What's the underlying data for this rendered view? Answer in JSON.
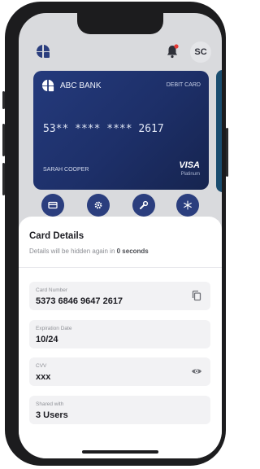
{
  "header": {
    "avatar_initials": "SC"
  },
  "card": {
    "bank_name": "ABC BANK",
    "type": "DEBIT CARD",
    "masked_number": "53** **** **** 2617",
    "holder": "SARAH COOPER",
    "network": "VISA",
    "tier": "Platinum"
  },
  "actions": [
    {
      "icon": "card-icon"
    },
    {
      "icon": "gear-icon"
    },
    {
      "icon": "wrench-icon"
    },
    {
      "icon": "snowflake-icon"
    }
  ],
  "sheet": {
    "title": "Card Details",
    "subtitle_prefix": "Details will be hidden again in ",
    "subtitle_time": "0 seconds",
    "fields": [
      {
        "label": "Card Number",
        "value": "5373 6846 9647 2617",
        "icon": "copy-icon"
      },
      {
        "label": "Expiration Date",
        "value": "10/24"
      },
      {
        "label": "CVV",
        "value": "xxx",
        "icon": "eye-icon"
      },
      {
        "label": "Shared with",
        "value": "3 Users"
      }
    ]
  },
  "colors": {
    "card": "#1d2f68",
    "action_button": "#2b3e7e",
    "sheet": "#ffffff",
    "field_bg": "#f2f2f4"
  }
}
